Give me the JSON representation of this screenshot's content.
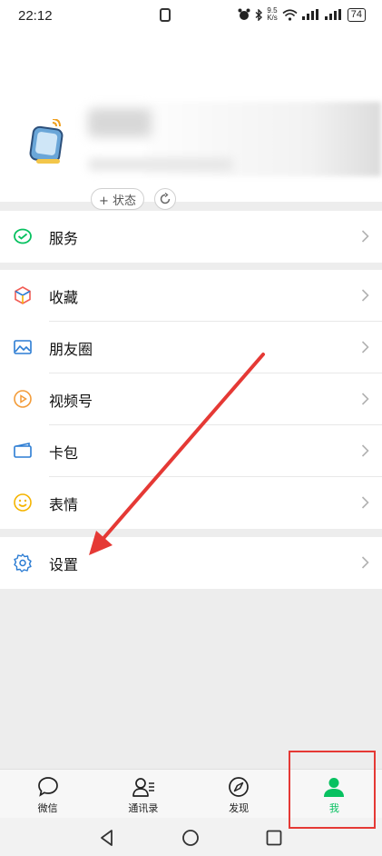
{
  "status_bar": {
    "time": "22:12",
    "speed_value": "9.5",
    "speed_unit": "K/s",
    "battery": "74",
    "icons": [
      "nfc-icon",
      "alarm-icon",
      "bluetooth-icon",
      "wifi-icon",
      "signal-icon",
      "signal-icon",
      "battery-icon"
    ]
  },
  "profile": {
    "avatar_icon": "tablet-wifi-avatar",
    "status_button_label": "+ 状态",
    "refresh_icon": "refresh-icon"
  },
  "menu": {
    "services": [
      {
        "label": "服务",
        "icon": "service-check-icon"
      }
    ],
    "main": [
      {
        "label": "收藏",
        "icon": "favorites-cube-icon"
      },
      {
        "label": "朋友圈",
        "icon": "moments-image-icon"
      },
      {
        "label": "视频号",
        "icon": "channels-play-icon"
      },
      {
        "label": "卡包",
        "icon": "card-wallet-icon"
      },
      {
        "label": "表情",
        "icon": "sticker-smile-icon"
      }
    ],
    "settings": [
      {
        "label": "设置",
        "icon": "settings-gear-icon"
      }
    ]
  },
  "tabbar": {
    "tabs": [
      {
        "label": "微信",
        "icon": "chat-bubble-icon",
        "active": false
      },
      {
        "label": "通讯录",
        "icon": "contacts-icon",
        "active": false
      },
      {
        "label": "发现",
        "icon": "compass-icon",
        "active": false
      },
      {
        "label": "我",
        "icon": "person-icon",
        "active": true
      }
    ]
  },
  "colors": {
    "accent": "#07c160",
    "annotation": "#e53935"
  }
}
